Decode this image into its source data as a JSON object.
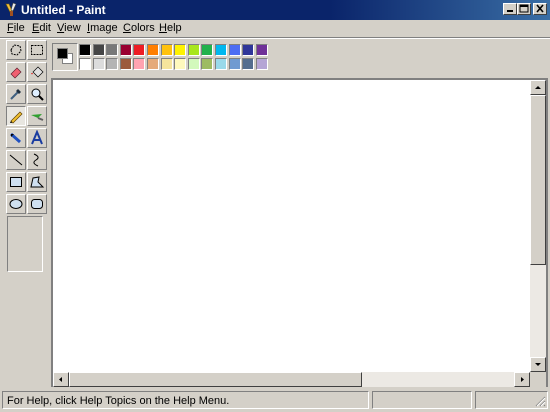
{
  "window": {
    "title": "Untitled - Paint"
  },
  "menu": [
    "File",
    "Edit",
    "View",
    "Image",
    "Colors",
    "Help"
  ],
  "menu_access_keys": [
    "F",
    "E",
    "V",
    "I",
    "C",
    "H"
  ],
  "tools": [
    {
      "name": "free-form-select-tool",
      "icon": "free-form-select-icon"
    },
    {
      "name": "select-tool",
      "icon": "select-icon"
    },
    {
      "name": "eraser-tool",
      "icon": "eraser-icon"
    },
    {
      "name": "fill-with-color-tool",
      "icon": "paint-bucket-icon"
    },
    {
      "name": "pick-color-tool",
      "icon": "eyedropper-icon"
    },
    {
      "name": "magnifier-tool",
      "icon": "magnifier-icon"
    },
    {
      "name": "pencil-tool",
      "icon": "pencil-icon",
      "pressed": true
    },
    {
      "name": "brush-tool",
      "icon": "brush-icon"
    },
    {
      "name": "airbrush-tool",
      "icon": "airbrush-icon"
    },
    {
      "name": "text-tool",
      "icon": "text-icon"
    },
    {
      "name": "line-tool",
      "icon": "line-icon"
    },
    {
      "name": "curve-tool",
      "icon": "curve-icon"
    },
    {
      "name": "rectangle-tool",
      "icon": "rectangle-icon"
    },
    {
      "name": "polygon-tool",
      "icon": "polygon-icon"
    },
    {
      "name": "ellipse-tool",
      "icon": "ellipse-icon"
    },
    {
      "name": "rounded-rectangle-tool",
      "icon": "rounded-rectangle-icon"
    }
  ],
  "colors": {
    "foreground": "#000000",
    "background": "#ffffff",
    "palette_top": [
      "#000000",
      "#464646",
      "#787878",
      "#990030",
      "#ed1c24",
      "#ff7e00",
      "#ffc20e",
      "#fff200",
      "#a8e61d",
      "#22b14c",
      "#00b7ef",
      "#4d6df3",
      "#2f3699",
      "#6f3198"
    ],
    "palette_bottom": [
      "#ffffff",
      "#dcdcdc",
      "#b4b4b4",
      "#9c5a3c",
      "#ffa3b1",
      "#e5aa7a",
      "#f5e49c",
      "#fff9bd",
      "#d3f9bc",
      "#9dbb61",
      "#99d9ea",
      "#709ad1",
      "#546d8e",
      "#b5a5d5"
    ]
  },
  "status": {
    "help_text": "For Help, click Help Topics on the Help Menu.",
    "position": "",
    "size": ""
  }
}
